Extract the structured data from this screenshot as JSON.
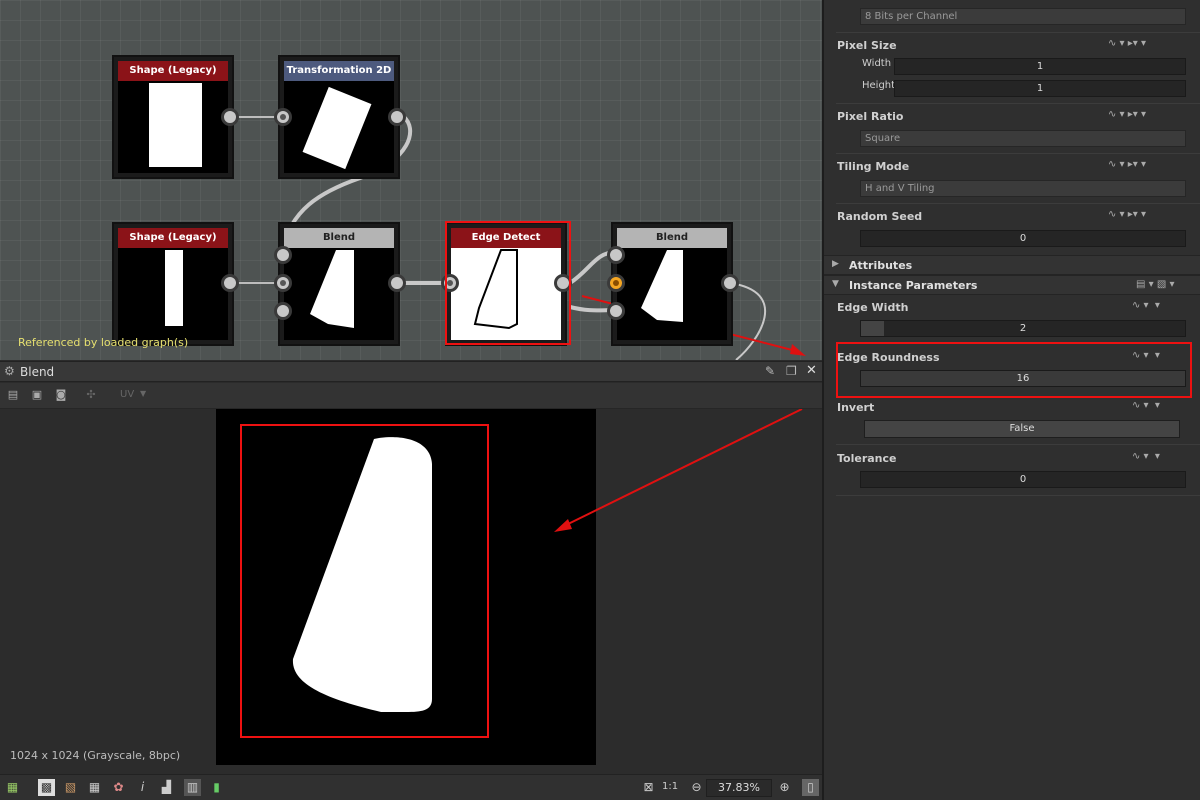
{
  "graph": {
    "reference_text": "Referenced by loaded graph(s)",
    "nodes": [
      {
        "title": "Shape (Legacy)",
        "color": "#8b1318"
      },
      {
        "title": "Transformation 2D",
        "color": "#4d5a7e"
      },
      {
        "title": "Shape (Legacy)",
        "color": "#8b1318"
      },
      {
        "title": "Blend",
        "color": "#b4b4b4"
      },
      {
        "title": "Edge Detect",
        "color": "#8b1318"
      },
      {
        "title": "Blend",
        "color": "#b4b4b4"
      }
    ]
  },
  "view": {
    "title": "Blend",
    "uv_label": "UV",
    "resolution": "1024 x 1024 (Grayscale, 8bpc)",
    "ratio_label": "1:1",
    "zoom": "37.83%",
    "info_icon": "i"
  },
  "panel": {
    "top_field_value": "8 Bits per Channel",
    "pixel_size": {
      "label": "Pixel Size",
      "width_label": "Width",
      "width_value": "1",
      "height_label": "Height",
      "height_value": "1"
    },
    "pixel_ratio": {
      "label": "Pixel Ratio",
      "value": "Square"
    },
    "tiling_mode": {
      "label": "Tiling Mode",
      "value": "H and V Tiling"
    },
    "random_seed": {
      "label": "Random Seed",
      "value": "0"
    },
    "attributes": {
      "label": "Attributes"
    },
    "instance_parameters": {
      "label": "Instance Parameters"
    },
    "edge_width": {
      "label": "Edge Width",
      "value": "2",
      "fraction": 0.07
    },
    "edge_roundness": {
      "label": "Edge Roundness",
      "value": "16",
      "fraction": 0.0
    },
    "invert": {
      "label": "Invert",
      "value": "False"
    },
    "tolerance": {
      "label": "Tolerance",
      "value": "0"
    }
  },
  "colors": {
    "highlight": "#e01010",
    "accent_orange": "#f5a623"
  }
}
